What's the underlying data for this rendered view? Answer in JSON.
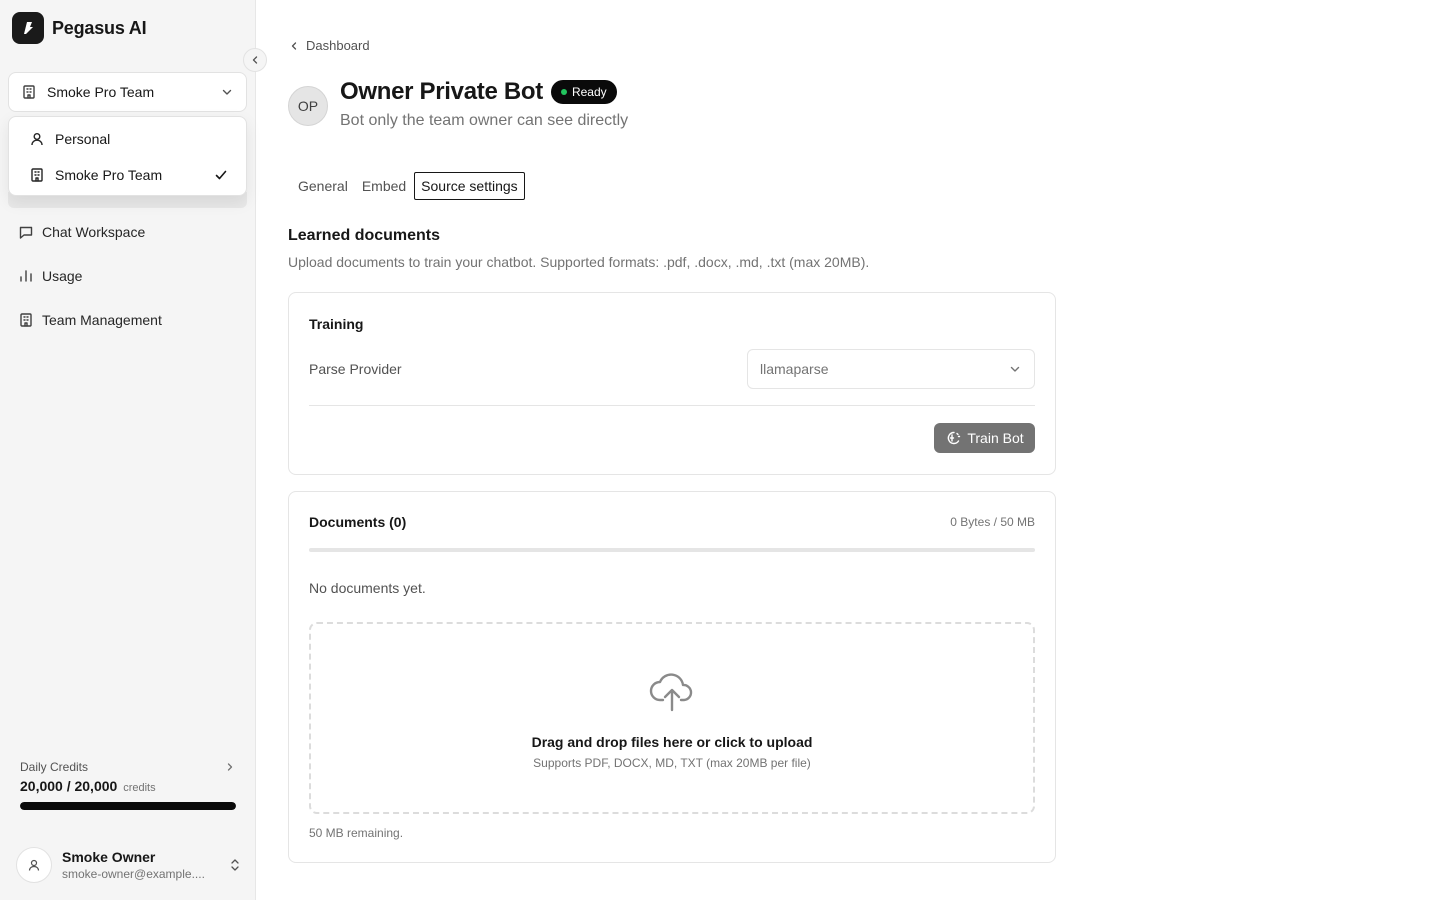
{
  "brand": {
    "name": "Pegasus AI"
  },
  "team_switcher": {
    "selected": "Smoke Pro Team",
    "options": [
      {
        "label": "Personal",
        "icon": "user-icon",
        "checked": false
      },
      {
        "label": "Smoke Pro Team",
        "icon": "building-icon",
        "checked": true
      }
    ]
  },
  "nav": [
    {
      "label": "Chat Workspace",
      "icon": "message-square-icon"
    },
    {
      "label": "Usage",
      "icon": "bar-chart-icon"
    },
    {
      "label": "Team Management",
      "icon": "building-icon"
    }
  ],
  "credits": {
    "label": "Daily Credits",
    "value": "20,000 / 20,000",
    "unit": "credits",
    "fraction": 1.0
  },
  "user": {
    "name": "Smoke Owner",
    "email": "smoke-owner@example...."
  },
  "breadcrumb": {
    "label": "Dashboard"
  },
  "bot": {
    "initials": "OP",
    "name": "Owner Private Bot",
    "status": "Ready",
    "description": "Bot only the team owner can see directly"
  },
  "tabs": [
    {
      "label": "General",
      "active": false
    },
    {
      "label": "Embed",
      "active": false
    },
    {
      "label": "Source settings",
      "active": true
    }
  ],
  "learned": {
    "title": "Learned documents",
    "description": "Upload documents to train your chatbot. Supported formats: .pdf, .docx, .md, .txt (max 20MB)."
  },
  "training": {
    "title": "Training",
    "parse_label": "Parse Provider",
    "parse_value": "llamaparse",
    "train_label": "Train Bot"
  },
  "documents": {
    "title": "Documents (0)",
    "size_info": "0 Bytes / 50 MB",
    "storage_fraction": 0,
    "empty": "No documents yet.",
    "upload_title": "Drag and drop files here or click to upload",
    "upload_sub": "Supports PDF, DOCX, MD, TXT (max 20MB per file)",
    "remaining": "50 MB remaining."
  },
  "colors": {
    "accent": "#0a0a0a",
    "status_dot": "#22c55e",
    "muted_text": "#737373",
    "sidebar_bg": "#f5f5f5"
  }
}
